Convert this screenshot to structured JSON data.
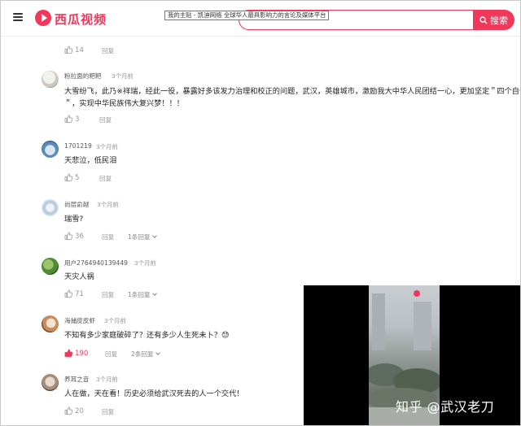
{
  "header": {
    "logo_text": "西瓜视频",
    "tooltip": "我的主贴 - 凯迪网络 全球华人最具影响力的言论及媒体平台",
    "search_label": "搜索"
  },
  "reply_label": "回复",
  "comments": [
    {
      "user": "",
      "time": "",
      "lines": [],
      "likes": "14",
      "more": ""
    },
    {
      "user": "粉拉面的粑粑",
      "time": "3个月前",
      "lines": [
        "大雪纷飞，此乃※祥瑞，经此一役，暴露好多该发力治理和校正的问题，武汉，英雄城市，激励我大中华人民团结一心，更加坚定＂四个自信",
        "＂，实现中华民族伟大复兴梦！！！"
      ],
      "likes": "3",
      "more": ""
    },
    {
      "user": "1701219",
      "time": "3个月前",
      "lines": [
        "天悲泣，低民泪"
      ],
      "likes": "5",
      "more": ""
    },
    {
      "user": "尚层俞越",
      "time": "3个月前",
      "lines": [
        "瑞雪?"
      ],
      "likes": "36",
      "more": "1条回复"
    },
    {
      "user": "用户2764940139449",
      "time": "3个月前",
      "lines": [
        "天灾人祸"
      ],
      "likes": "71",
      "more": "1条回复"
    },
    {
      "user": "海捕皮皮虾",
      "time": "3个月前",
      "lines": [
        "不知有多少家庭破碎了？还有多少人生死未卜？😓"
      ],
      "likes": "190",
      "more": "2条回复"
    },
    {
      "user": "养耳之音",
      "time": "3个月前",
      "lines": [
        "人在做，天在看！历史必须给武汉死去的人一个交代！"
      ],
      "likes": "20",
      "more": ""
    }
  ],
  "video": {
    "watermark": "知乎 @武汉老刀"
  }
}
